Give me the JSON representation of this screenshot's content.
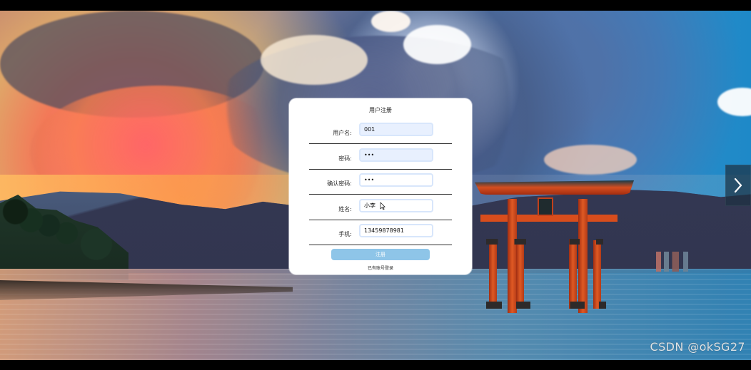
{
  "form": {
    "title": "用户注册",
    "fields": [
      {
        "label": "用户名:",
        "value": "001"
      },
      {
        "label": "密码:",
        "value": "•••"
      },
      {
        "label": "确认密码:",
        "value": "•••"
      },
      {
        "label": "姓名:",
        "value": "小李"
      },
      {
        "label": "手机:",
        "value": "13459878981"
      }
    ],
    "register_button": "注册",
    "login_link": "已有账号登录"
  },
  "overlay": {
    "watermark": "CSDN @okSG27"
  },
  "icons": {
    "next": "chevron-right-icon",
    "cursor": "mouse-pointer-icon"
  },
  "colors": {
    "button": "#8ec5e8",
    "filled_input": "#e8f0fe",
    "input_border": "#d8e6fb"
  }
}
